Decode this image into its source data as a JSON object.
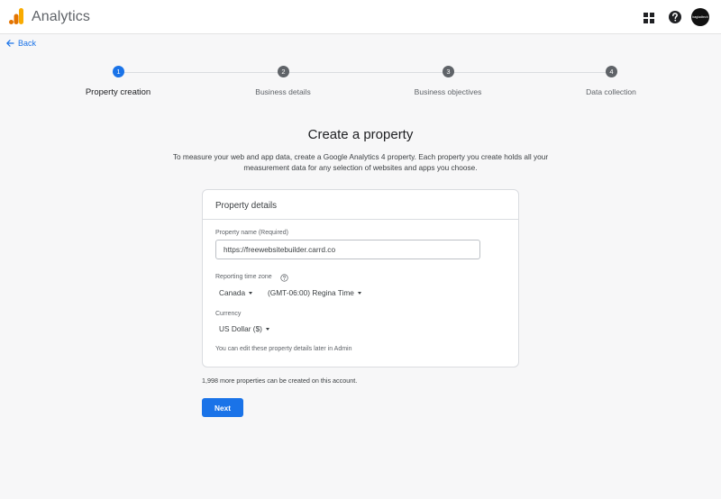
{
  "header": {
    "app_title": "Analytics",
    "logo_icon": "analytics-bars-logo",
    "apps_icon": "apps-grid-icon",
    "help_icon": "help-icon",
    "avatar_text": "bagladtech",
    "brand_colors": {
      "logo_yellow": "#f9ab00",
      "logo_orange": "#e37400"
    }
  },
  "nav": {
    "back_label": "Back",
    "back_icon": "arrow-back-icon"
  },
  "stepper": {
    "active_color": "#1a73e8",
    "steps": [
      {
        "number": "1",
        "label": "Property creation"
      },
      {
        "number": "2",
        "label": "Business details"
      },
      {
        "number": "3",
        "label": "Business objectives"
      },
      {
        "number": "4",
        "label": "Data collection"
      }
    ]
  },
  "page": {
    "title": "Create a property",
    "description": "To measure your web and app data, create a Google Analytics 4 property. Each property you create holds all your measurement data for any selection of websites and apps you choose."
  },
  "card": {
    "title": "Property details",
    "property_name": {
      "label": "Property name (Required)",
      "value": "https://freewebsitebuilder.carrd.co"
    },
    "time_zone": {
      "label": "Reporting time zone",
      "country": "Canada",
      "zone": "(GMT-06:00) Regina Time"
    },
    "currency": {
      "label": "Currency",
      "value": "US Dollar ($)"
    },
    "hint": "You can edit these property details later in Admin"
  },
  "footer": {
    "remaining_text": "1,998 more properties can be created on this account.",
    "next_label": "Next"
  }
}
